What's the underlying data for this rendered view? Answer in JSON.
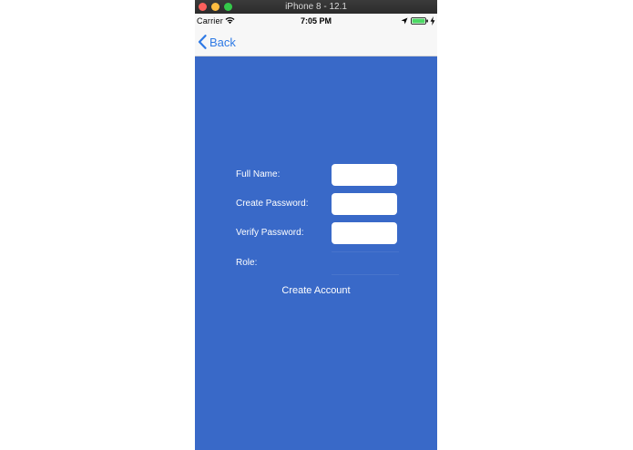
{
  "window": {
    "title": "iPhone 8 - 12.1"
  },
  "status_bar": {
    "carrier": "Carrier",
    "time": "7:05 PM",
    "icons": [
      "wifi-icon",
      "location-icon",
      "battery-icon",
      "charging-icon"
    ]
  },
  "nav": {
    "back_label": "Back",
    "accent_color": "#2f7ae5"
  },
  "form": {
    "background_color": "#3969c8",
    "full_name_label": "Full Name:",
    "full_name_value": "",
    "create_password_label": "Create Password:",
    "create_password_value": "",
    "verify_password_label": "Verify Password:",
    "verify_password_value": "",
    "role_label": "Role:",
    "submit_label": "Create Account"
  }
}
